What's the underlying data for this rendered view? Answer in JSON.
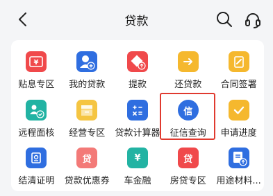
{
  "header": {
    "title": "贷款"
  },
  "services": [
    {
      "label": "贴息专区",
      "icon": "discount-yen-icon",
      "color": "#f0494b"
    },
    {
      "label": "我的贷款",
      "icon": "user-add-icon",
      "color": "#2f6ee0"
    },
    {
      "label": "提款",
      "icon": "withdraw-icon",
      "color": "#f0494b"
    },
    {
      "label": "还贷款",
      "icon": "repay-arrow-icon",
      "color": "#f5b82e"
    },
    {
      "label": "合同签署",
      "icon": "contract-sign-icon",
      "color": "#f5b82e"
    },
    {
      "label": "远程面核",
      "icon": "remote-verify-icon",
      "color": "#22b3a3"
    },
    {
      "label": "经营专区",
      "icon": "business-icon",
      "color": "#f5c542"
    },
    {
      "label": "贷款计算器",
      "icon": "calculator-icon",
      "color": "#2f6ee0"
    },
    {
      "label": "征信查询",
      "icon": "credit-query-icon",
      "color": "#2f6ee0",
      "icon_text": "信"
    },
    {
      "label": "申请进度",
      "icon": "progress-check-icon",
      "color": "#f5b82e"
    },
    {
      "label": "结清证明",
      "icon": "settlement-proof-icon",
      "color": "#2f6ee0"
    },
    {
      "label": "贷款优惠券",
      "icon": "coupon-icon",
      "color": "#f37a78",
      "icon_text": "贷"
    },
    {
      "label": "车金融",
      "icon": "car-finance-icon",
      "color": "#22b3a3",
      "icon_text": "¥"
    },
    {
      "label": "房贷专区",
      "icon": "house-loan-icon",
      "color": "#f0494b",
      "icon_text": "贷"
    },
    {
      "label": "用途材料...",
      "icon": "materials-upload-icon",
      "color": "#2f6ee0"
    }
  ]
}
